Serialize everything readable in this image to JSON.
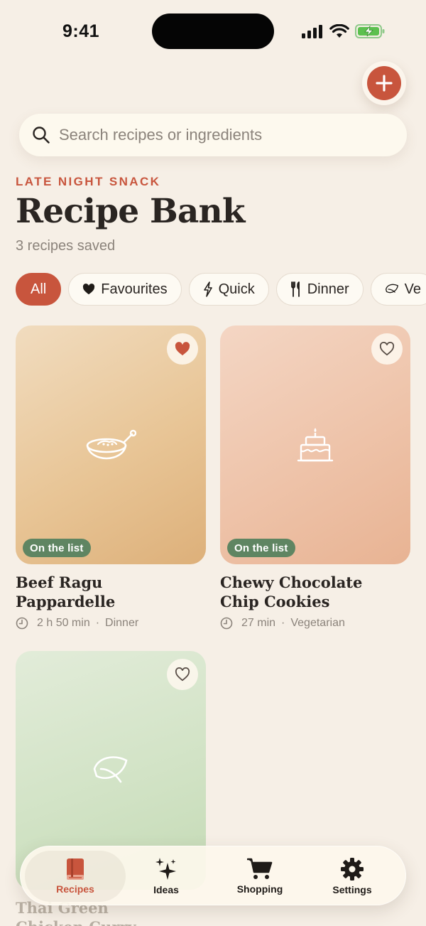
{
  "status": {
    "time": "9:41"
  },
  "search": {
    "placeholder": "Search recipes or ingredients"
  },
  "header": {
    "eyebrow": "LATE NIGHT SNACK",
    "title": "Recipe Bank",
    "subtitle": "3 recipes saved"
  },
  "filters": [
    {
      "label": "All",
      "icon": "none",
      "active": true
    },
    {
      "label": "Favourites",
      "icon": "heart-icon",
      "active": false
    },
    {
      "label": "Quick",
      "icon": "bolt-icon",
      "active": false
    },
    {
      "label": "Dinner",
      "icon": "fork-knife-icon",
      "active": false
    },
    {
      "label": "Ve",
      "icon": "leaf-icon",
      "active": false
    }
  ],
  "recipes": [
    {
      "title_line1": "Beef Ragu Pappardelle",
      "title_line2": "",
      "time": "2 h 50 min",
      "category": "Dinner",
      "badge": "On the list",
      "favourite": true,
      "icon": "pan-icon"
    },
    {
      "title_line1": "Chewy Chocolate",
      "title_line2": "Chip Cookies",
      "time": "27 min",
      "category": "Vegetarian",
      "badge": "On the list",
      "favourite": false,
      "icon": "cake-icon"
    },
    {
      "title_line1": "Thai Green",
      "title_line2": "Chicken Curry",
      "favourite": false,
      "icon": "leaf-icon"
    }
  ],
  "tabs": [
    {
      "label": "Recipes",
      "icon": "book-icon",
      "active": true
    },
    {
      "label": "Ideas",
      "icon": "sparkles-icon",
      "active": false
    },
    {
      "label": "Shopping",
      "icon": "cart-icon",
      "active": false
    },
    {
      "label": "Settings",
      "icon": "gear-icon",
      "active": false
    }
  ],
  "colors": {
    "background": "#f6efe6",
    "accent": "#c8553d",
    "badge": "#5f8562",
    "text": "#2a2522",
    "muted": "#8b837b"
  }
}
